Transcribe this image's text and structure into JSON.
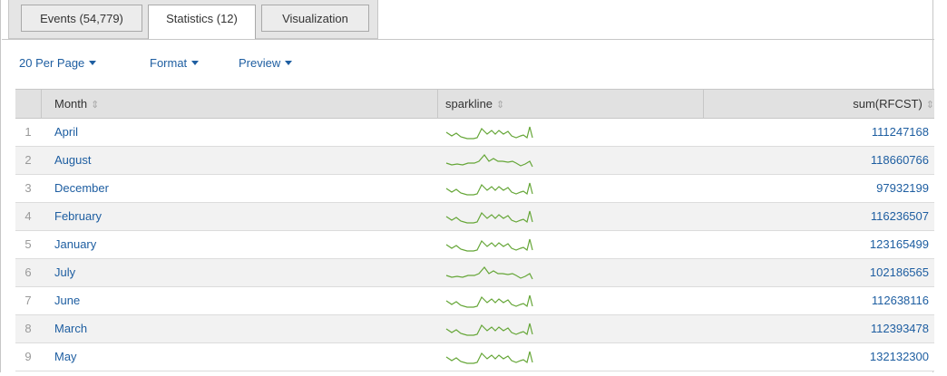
{
  "tabs": [
    {
      "label": "Events (54,779)",
      "active": false
    },
    {
      "label": "Statistics (12)",
      "active": true
    },
    {
      "label": "Visualization",
      "active": false
    }
  ],
  "toolbar": {
    "per_page": "20 Per Page",
    "format": "Format",
    "preview": "Preview"
  },
  "table": {
    "columns": {
      "month": "Month",
      "sparkline": "sparkline",
      "sum": "sum(RFCST)"
    },
    "sort_icon": "⇕",
    "rows": [
      {
        "num": "1",
        "month": "April",
        "sum": "111247168",
        "spark": "a"
      },
      {
        "num": "2",
        "month": "August",
        "sum": "118660766",
        "spark": "b"
      },
      {
        "num": "3",
        "month": "December",
        "sum": "97932199",
        "spark": "a"
      },
      {
        "num": "4",
        "month": "February",
        "sum": "116236507",
        "spark": "a"
      },
      {
        "num": "5",
        "month": "January",
        "sum": "123165499",
        "spark": "a"
      },
      {
        "num": "6",
        "month": "July",
        "sum": "102186565",
        "spark": "b"
      },
      {
        "num": "7",
        "month": "June",
        "sum": "112638116",
        "spark": "a"
      },
      {
        "num": "8",
        "month": "March",
        "sum": "112393478",
        "spark": "a"
      },
      {
        "num": "9",
        "month": "May",
        "sum": "132132300",
        "spark": "a"
      }
    ]
  },
  "colors": {
    "link": "#1e5ea1",
    "sparkline": "#65a637",
    "header_bg": "#e1e1e1",
    "row_alt_bg": "#f2f2f2"
  }
}
